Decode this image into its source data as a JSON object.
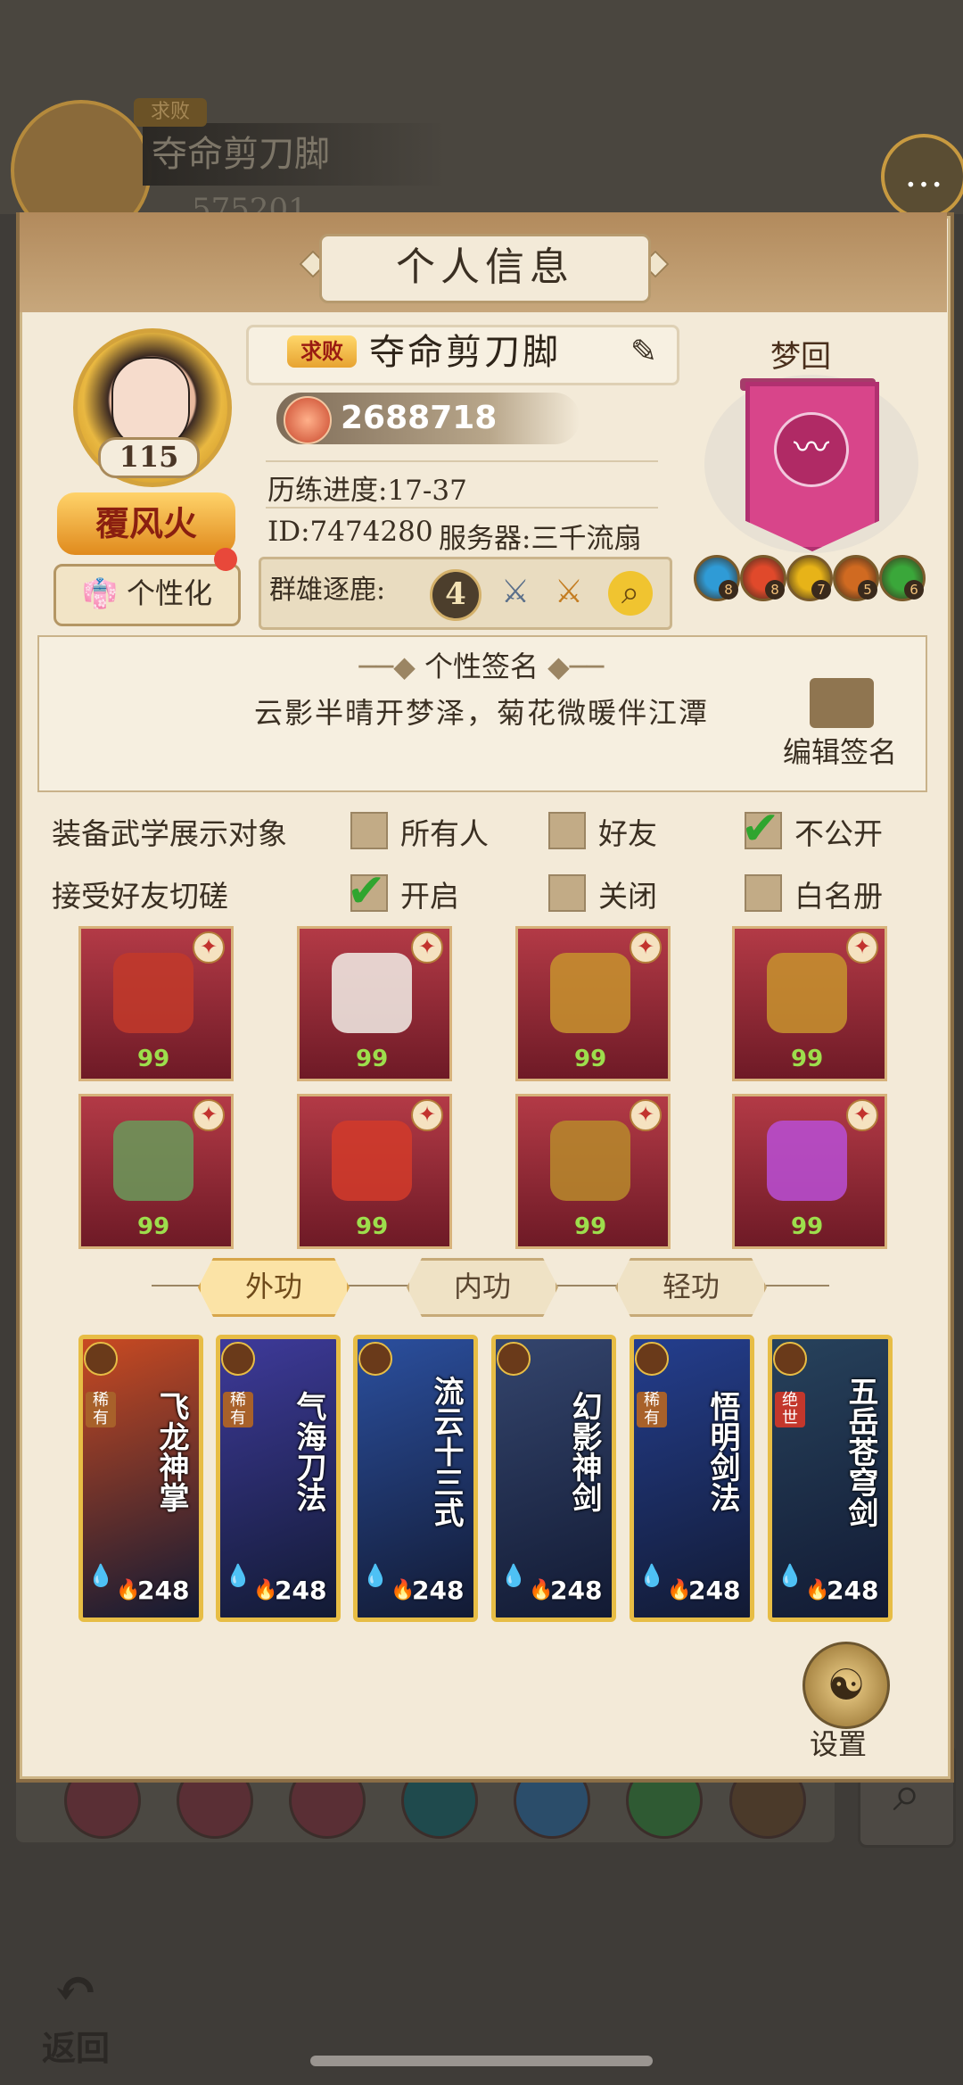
{
  "background": {
    "rank_tag": "求败",
    "player_name": "夺命剪刀脚",
    "power_partial": "575201"
  },
  "header": {
    "title": "个人信息"
  },
  "profile": {
    "level": "115",
    "title_badge": "覆风火",
    "customize_label": "个性化",
    "rank_tag": "求败",
    "name": "夺命剪刀脚",
    "power": "2688718",
    "progress": "历练进度:17-37",
    "id": "ID:7474280",
    "server": "服务器:三千流扇",
    "arena_label": "群雄逐鹿:",
    "arena_rank": "4"
  },
  "dream": {
    "label": "梦回",
    "gems": [
      "8",
      "8",
      "7",
      "5",
      "6"
    ],
    "gem_colors": [
      "#2f9bd6",
      "#e0492b",
      "#e7b318",
      "#d06a21",
      "#3aa73a"
    ]
  },
  "signature": {
    "title": "个性签名",
    "text": "云影半晴开梦泽，菊花微暖伴江潭",
    "edit_label": "编辑签名"
  },
  "settings": {
    "row1_label": "装备武学展示对象",
    "row1_options": [
      "所有人",
      "好友",
      "不公开"
    ],
    "row1_selected": "不公开",
    "row2_label": "接受好友切磋",
    "row2_options": [
      "开启",
      "关闭",
      "白名册"
    ],
    "row2_selected": "开启"
  },
  "equipment": [
    {
      "icon": "sword-icon",
      "level": "99"
    },
    {
      "icon": "robe-icon",
      "level": "99"
    },
    {
      "icon": "belt-icon",
      "level": "99"
    },
    {
      "icon": "boots-icon",
      "level": "99"
    },
    {
      "icon": "necklace-icon",
      "level": "99"
    },
    {
      "icon": "hairpin-icon",
      "level": "99"
    },
    {
      "icon": "bracelet-icon",
      "level": "99"
    },
    {
      "icon": "ring-icon",
      "level": "99"
    }
  ],
  "tabs": [
    "外功",
    "内功",
    "轻功"
  ],
  "active_tab": "外功",
  "skills": [
    {
      "name": "飞龙神掌",
      "tag": "稀有",
      "level": "248",
      "color": "#c94a22"
    },
    {
      "name": "气海刀法",
      "tag": "稀有",
      "level": "248",
      "color": "#3e3a9a"
    },
    {
      "name": "流云十三式",
      "tag": "",
      "level": "248",
      "color": "#2b4f9e"
    },
    {
      "name": "幻影神剑",
      "tag": "",
      "level": "248",
      "color": "#34456d"
    },
    {
      "name": "悟明剑法",
      "tag": "稀有",
      "level": "248",
      "color": "#243e8e"
    },
    {
      "name": "五岳苍穹剑",
      "tag": "绝世",
      "level": "248",
      "color": "#27425c"
    }
  ],
  "footer": {
    "settings_label": "设置",
    "back_label": "返回"
  }
}
